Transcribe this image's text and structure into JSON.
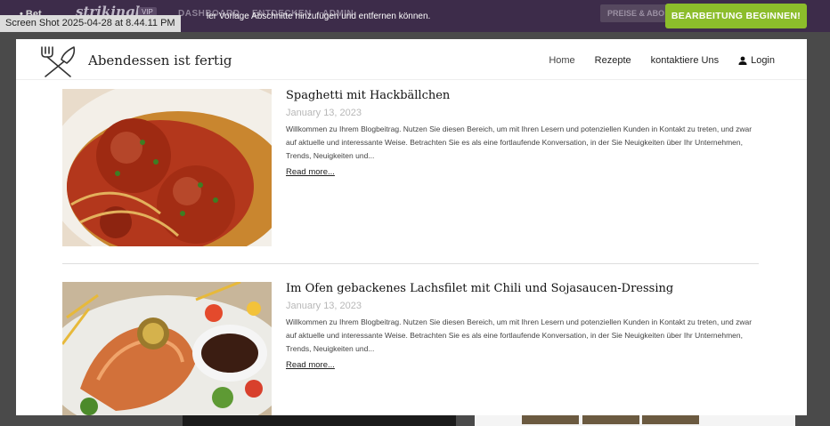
{
  "app_bar": {
    "left_text": "• Bet",
    "brand": "strikingly",
    "vip_badge": "VIP",
    "nav": [
      "DASHBOARD",
      "ENTDECKEN",
      "ADMIN"
    ],
    "hint": "ler Vorlage Abschnitte hinzufügen und entfernen können.",
    "price_button": "PREISE & ABO",
    "edit_button": "BEARBEITUNG BEGINNEN!"
  },
  "screenshot_label": "Screen Shot 2025-04-28 at 8.44.11 PM",
  "site": {
    "title": "Abendessen ist fertig",
    "logo_icon": "crossed-fork-knife-icon",
    "nav": {
      "home": "Home",
      "recipes": "Rezepte",
      "contact": "kontaktiere Uns",
      "login": "Login"
    }
  },
  "posts": [
    {
      "title": "Spaghetti mit Hackbällchen",
      "date": "January 13, 2023",
      "excerpt": "Willkommen zu Ihrem Blogbeitrag. Nutzen Sie diesen Bereich, um mit Ihren Lesern und potenziellen Kunden in Kontakt zu treten, und zwar auf aktuelle und interessante Weise. Betrachten Sie es als eine fortlaufende Konversation, in der Sie Neuigkeiten über Ihr Unternehmen, Trends, Neuigkeiten und...",
      "read_more": "Read more...",
      "image": "spaghetti-meatballs-photo"
    },
    {
      "title": "Im Ofen gebackenes Lachsfilet mit Chili und Sojasaucen-Dressing",
      "date": "January 13, 2023",
      "excerpt": "Willkommen zu Ihrem Blogbeitrag. Nutzen Sie diesen Bereich, um mit Ihren Lesern und potenziellen Kunden in Kontakt zu treten, und zwar auf aktuelle und interessante Weise. Betrachten Sie es als eine fortlaufende Konversation, in der Sie Neuigkeiten über Ihr Unternehmen, Trends, Neuigkeiten und...",
      "read_more": "Read more...",
      "image": "baked-salmon-photo"
    }
  ],
  "colors": {
    "app_bar": "#3d2c4a",
    "edit_button": "#8cbd2b"
  }
}
